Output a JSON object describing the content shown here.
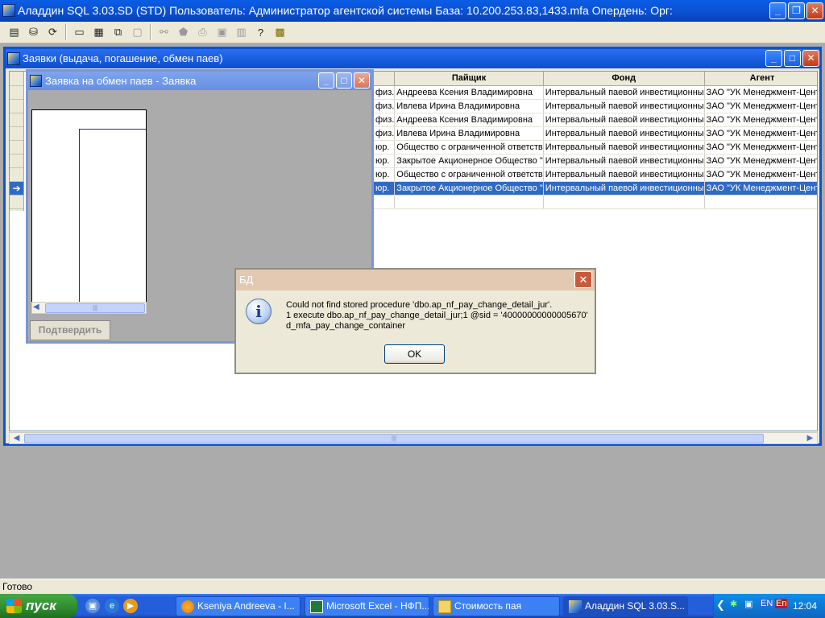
{
  "app": {
    "title": "Аладдин SQL 3.03.SD (STD)  Пользователь: Администратор агентской системы База: 10.200.253.83,1433.mfa Опердень:  Орг:"
  },
  "toolbar": {
    "tools": [
      {
        "icon": "document-icon"
      },
      {
        "icon": "database-icon"
      },
      {
        "icon": "refresh-icon"
      },
      {
        "icon": "window-single-icon"
      },
      {
        "icon": "window-tile-icon"
      },
      {
        "icon": "window-cascade-icon"
      },
      {
        "icon": "window-arrange-icon"
      },
      {
        "icon": "binoculars-icon"
      },
      {
        "icon": "tag-icon"
      },
      {
        "icon": "printer-icon"
      },
      {
        "icon": "save-icon"
      },
      {
        "icon": "calendar-icon"
      },
      {
        "icon": "help-icon"
      },
      {
        "icon": "app-settings-icon"
      }
    ]
  },
  "zayavki_window": {
    "title": "Заявки (выдача, погашение, обмен паев)",
    "columns": [
      "Пайщик",
      "Фонд",
      "Агент"
    ],
    "rows": [
      {
        "type": "физ.",
        "shareholder": "Андреева Ксения Владимировна",
        "fund": "Интервальный паевой инвестиционны",
        "agent": "ЗАО \"УК Менеджмент-Цент"
      },
      {
        "type": "физ.",
        "shareholder": "Ивлева  Ирина Владимировна",
        "fund": "Интервальный паевой инвестиционны",
        "agent": "ЗАО \"УК Менеджмент-Цент"
      },
      {
        "type": "физ.",
        "shareholder": "Андреева Ксения Владимировна",
        "fund": "Интервальный паевой инвестиционны",
        "agent": "ЗАО \"УК Менеджмент-Цент"
      },
      {
        "type": "физ.",
        "shareholder": "Ивлева  Ирина Владимировна",
        "fund": "Интервальный паевой инвестиционны",
        "agent": "ЗАО \"УК Менеджмент-Цент"
      },
      {
        "type": "юр.",
        "shareholder": "Общество с ограниченной ответств",
        "fund": "Интервальный паевой инвестиционны",
        "agent": "ЗАО \"УК Менеджмент-Цент"
      },
      {
        "type": "юр.",
        "shareholder": "Закрытое Акционерное Общество \"",
        "fund": "Интервальный паевой инвестиционны",
        "agent": "ЗАО \"УК Менеджмент-Цент"
      },
      {
        "type": "юр.",
        "shareholder": "Общество с ограниченной ответств",
        "fund": "Интервальный паевой инвестиционны",
        "agent": "ЗАО \"УК Менеджмент-Цент"
      },
      {
        "type": "юр.",
        "shareholder": "Закрытое Акционерное Общество \"",
        "fund": "Интервальный паевой инвестиционны",
        "agent": "ЗАО \"УК Менеджмент-Цент",
        "selected": true
      },
      {
        "type": "",
        "shareholder": "",
        "fund": "",
        "agent": ""
      }
    ],
    "selected_row_marker": "➔"
  },
  "obmen_window": {
    "title": "Заявка на обмен паев - Заявка",
    "confirm_label": "Подтвердить"
  },
  "dialog": {
    "title": "БД",
    "line1": "Could not find stored procedure 'dbo.ap_nf_pay_change_detail_jur'.",
    "line2": "1 execute dbo.ap_nf_pay_change_detail_jur;1 @sid = '40000000000005670'",
    "line3": "d_mfa_pay_change_container",
    "ok_label": "OK"
  },
  "status": {
    "text": "Готово"
  },
  "taskbar": {
    "start_label": "пуск",
    "tasks": [
      {
        "label": "Kseniya Andreeva - I..."
      },
      {
        "label": "Microsoft Excel - НФП..."
      },
      {
        "label": "Стоимость пая"
      },
      {
        "label": "Аладдин SQL 3.03.S..."
      }
    ],
    "tray": {
      "lang1": "EN",
      "lang2": "En",
      "clock": "12:04"
    }
  }
}
